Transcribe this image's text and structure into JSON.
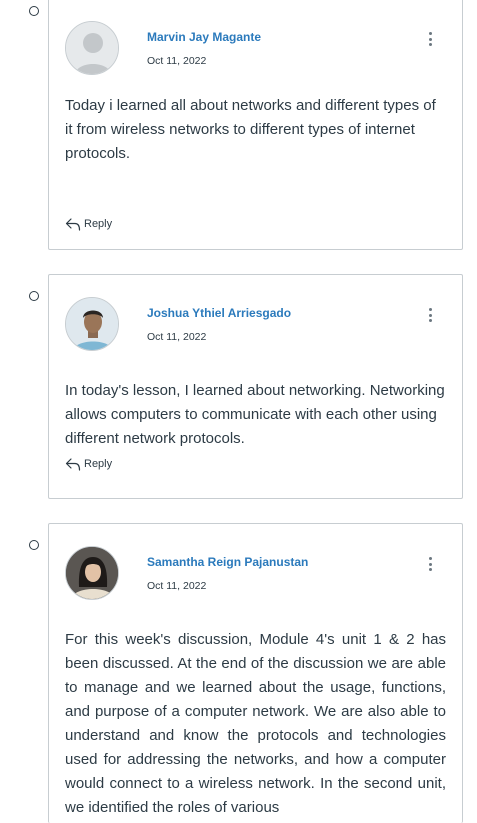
{
  "entries": [
    {
      "author": "Marvin Jay Magante",
      "date": "Oct 11, 2022",
      "message": "Today i learned all about networks and different types of it from wireless networks to different types of internet protocols.",
      "reply_label": "Reply",
      "avatar": "default-avatar"
    },
    {
      "author": "Joshua Ythiel Arriesgado",
      "date": "Oct 11, 2022",
      "message": "In today's lesson, I learned about networking. Networking allows computers to communicate with each other using different network protocols.",
      "reply_label": "Reply",
      "avatar": "photo-avatar"
    },
    {
      "author": "Samantha Reign Pajanustan",
      "date": "Oct 11, 2022",
      "message": "For this week's discussion, Module 4's unit 1 & 2 has been discussed. At the end of the discussion we are able to manage and we learned about the usage, functions, and purpose of a computer network. We are also able to understand and know the protocols and technologies used for addressing the networks, and how a computer would connect to a wireless network. In the second unit, we identified the roles of various",
      "avatar": "photo-avatar"
    }
  ],
  "icons": {
    "options": "kebab-menu-icon",
    "reply": "reply-arrow-icon"
  },
  "colors": {
    "author_link": "#2b7abc",
    "border": "#c7cdd1",
    "text": "#2d3b45"
  }
}
